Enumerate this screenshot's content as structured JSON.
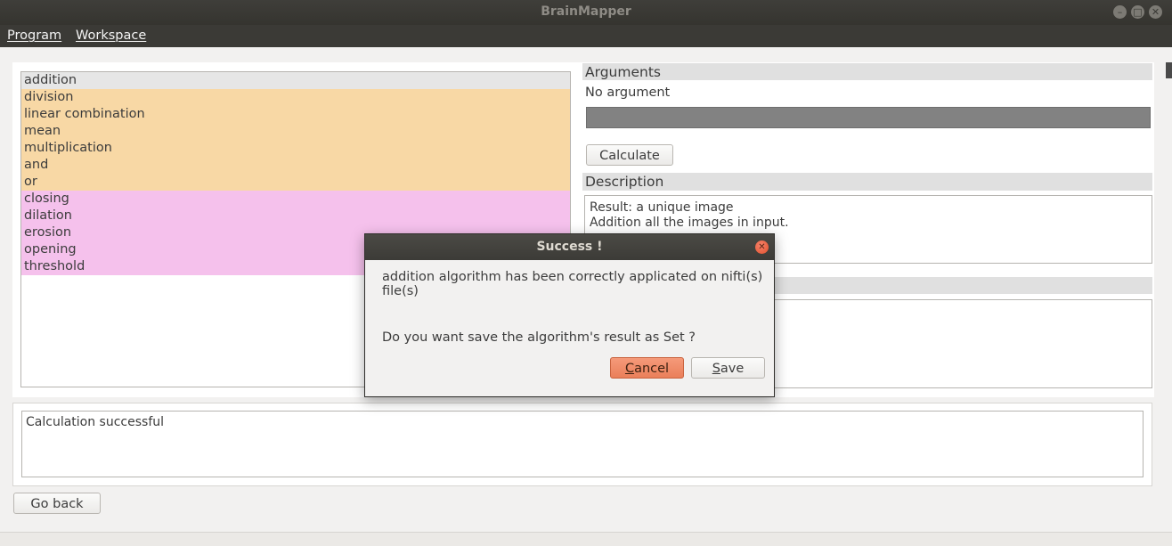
{
  "window": {
    "title": "BrainMapper"
  },
  "menu": {
    "program": "Program",
    "workspace": "Workspace"
  },
  "algorithms": [
    {
      "label": "addition",
      "group": "sel"
    },
    {
      "label": "division",
      "group": "orange"
    },
    {
      "label": "linear combination",
      "group": "orange"
    },
    {
      "label": "mean",
      "group": "orange"
    },
    {
      "label": "multiplication",
      "group": "orange"
    },
    {
      "label": "and",
      "group": "orange"
    },
    {
      "label": "or",
      "group": "orange"
    },
    {
      "label": "closing",
      "group": "pink"
    },
    {
      "label": "dilation",
      "group": "pink"
    },
    {
      "label": "erosion",
      "group": "pink"
    },
    {
      "label": "opening",
      "group": "pink"
    },
    {
      "label": "threshold",
      "group": "pink"
    }
  ],
  "arguments": {
    "header": "Arguments",
    "none_text": "No argument"
  },
  "calculate_button": "Calculate",
  "description": {
    "header": "Description",
    "line1": "Result: a unique image",
    "line2": "Addition all the images in input."
  },
  "status": {
    "text": "Calculation successful"
  },
  "go_back_button": "Go back",
  "dialog": {
    "title": "Success !",
    "message1": "addition algorithm has been correctly applicated on nifti(s) file(s)",
    "message2": "Do you want save the algorithm's result as Set ?",
    "cancel": "Cancel",
    "save": "Save"
  },
  "colors": {
    "orange": "#f8d8a5",
    "pink": "#f5c1ec",
    "selected": "#e6e6e6"
  },
  "icons": {
    "minimize": "minimize-icon",
    "maximize": "maximize-icon",
    "close": "close-icon"
  }
}
